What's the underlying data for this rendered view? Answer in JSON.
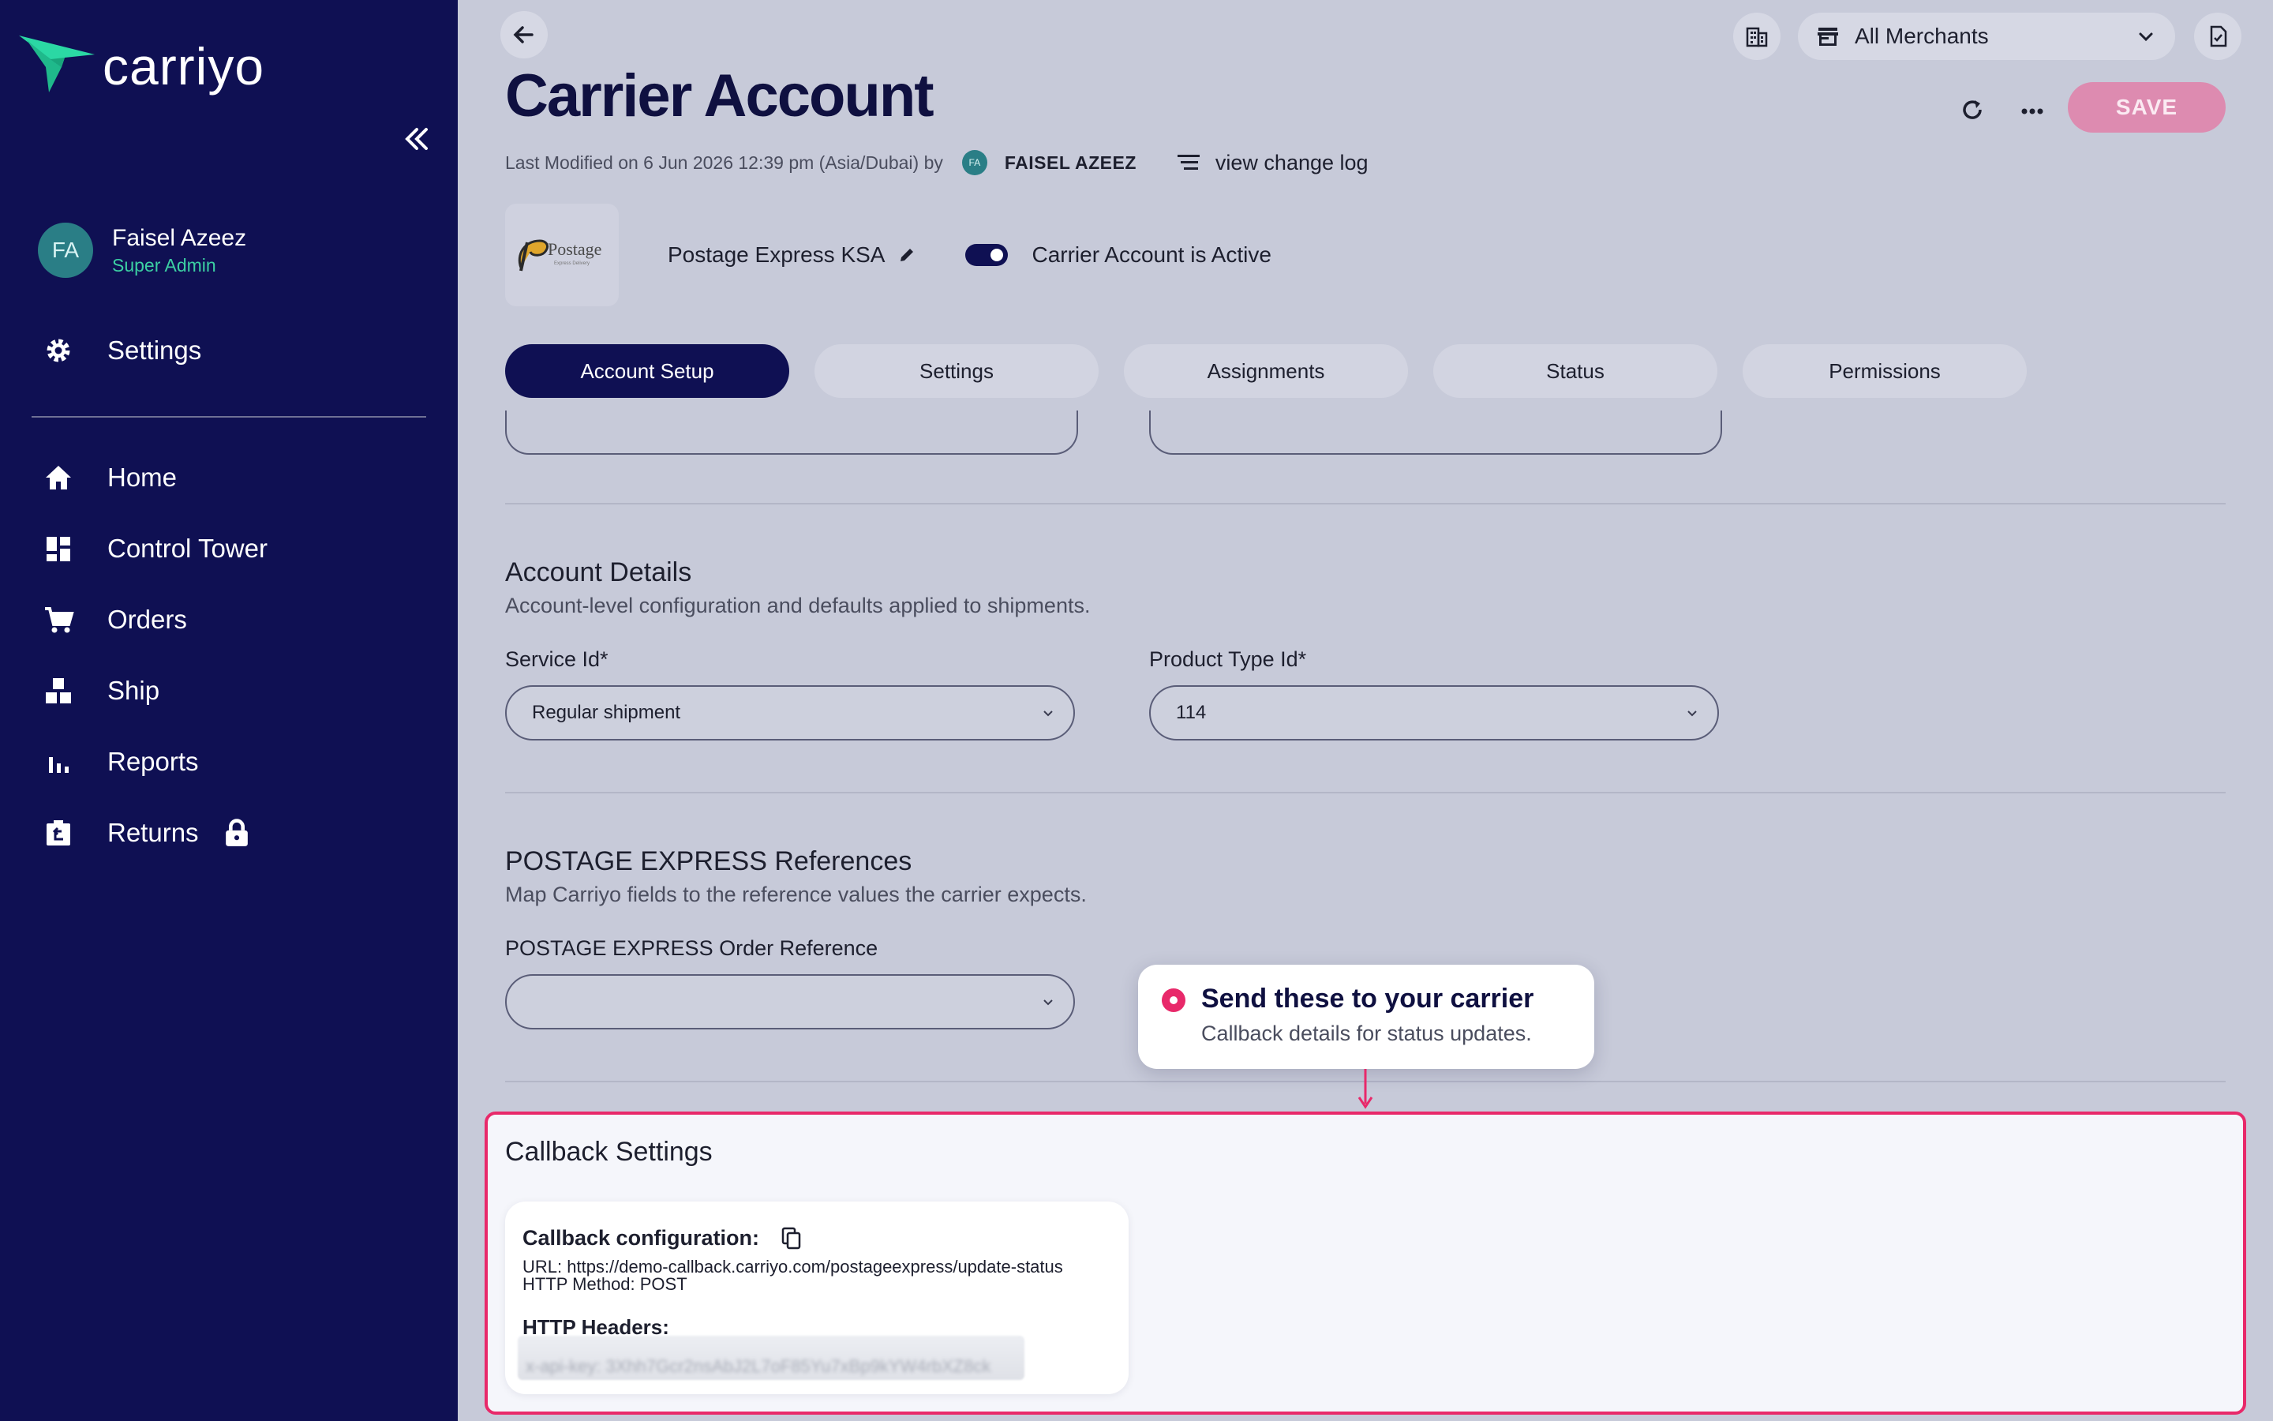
{
  "sidebar": {
    "logo_text": "carriyo",
    "user": {
      "initials": "FA",
      "name": "Faisel Azeez",
      "role": "Super Admin"
    },
    "settings_label": "Settings",
    "nav": [
      {
        "label": "Home",
        "icon": "home-icon"
      },
      {
        "label": "Control Tower",
        "icon": "dashboard-icon"
      },
      {
        "label": "Orders",
        "icon": "cart-icon"
      },
      {
        "label": "Ship",
        "icon": "boxes-icon"
      },
      {
        "label": "Reports",
        "icon": "bar-chart-icon"
      },
      {
        "label": "Returns",
        "icon": "return-box-icon",
        "locked": true
      }
    ]
  },
  "header": {
    "merchant_select": "All Merchants",
    "title": "Carrier Account",
    "save_label": "SAVE",
    "last_modified": "Last Modified on 6 Jun 2026 12:39 pm (Asia/Dubai) by",
    "modified_by_initials": "FA",
    "modified_by": "FAISEL AZEEZ",
    "changelog_label": "view change log"
  },
  "carrier": {
    "logo_text": "Postage",
    "logo_subtext": "Express Delivery",
    "name": "Postage Express KSA",
    "active_label": "Carrier Account is Active",
    "active": true
  },
  "tabs": [
    {
      "label": "Account Setup",
      "active": true
    },
    {
      "label": "Settings",
      "active": false
    },
    {
      "label": "Assignments",
      "active": false
    },
    {
      "label": "Status",
      "active": false
    },
    {
      "label": "Permissions",
      "active": false
    }
  ],
  "account_details": {
    "title": "Account Details",
    "subtitle": "Account-level configuration and defaults applied to shipments.",
    "service_id_label": "Service Id*",
    "service_id_value": "Regular shipment",
    "product_type_label": "Product Type Id*",
    "product_type_value": "114"
  },
  "references": {
    "title": "POSTAGE EXPRESS References",
    "subtitle": "Map Carriyo fields to the reference values the carrier expects.",
    "order_ref_label": "POSTAGE EXPRESS Order Reference",
    "order_ref_value": ""
  },
  "tooltip": {
    "title": "Send these to your carrier",
    "subtitle": "Callback details for status updates."
  },
  "callback": {
    "title": "Callback Settings",
    "config_label": "Callback configuration:",
    "url_line": "URL: https://demo-callback.carriyo.com/postageexpress/update-status",
    "method_line": "HTTP Method: POST",
    "headers_label": "HTTP Headers:",
    "header_line_blurred": "x-api-key: 3Xhh7Gcr2nsAbJ2L7oF85Yu7xBp9kYW4rbXZ8ck"
  },
  "colors": {
    "sidebar_bg": "#0f1053",
    "accent": "#e8296a",
    "save_disabled": "#dd8bb0",
    "role_green": "#3cd0a3"
  }
}
